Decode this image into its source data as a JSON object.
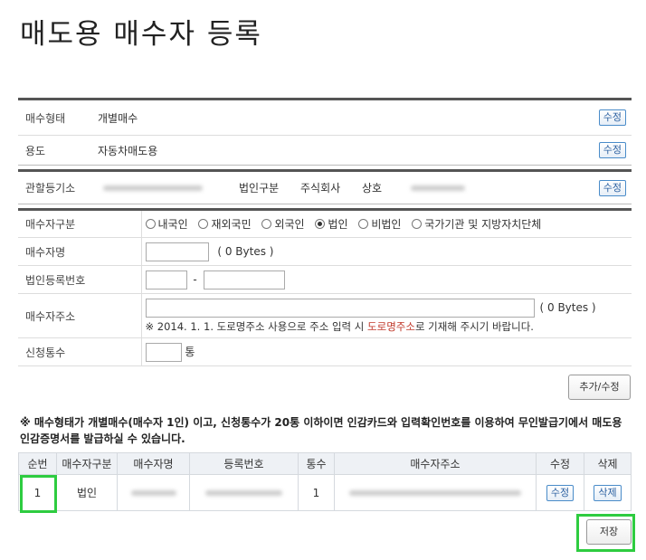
{
  "page_title": "매도용 매수자 등록",
  "top_info": {
    "buy_type_label": "매수형태",
    "buy_type_value": "개별매수",
    "usage_label": "용도",
    "usage_value": "자동차매도용",
    "edit_label": "수정"
  },
  "registry": {
    "office_label": "관할등기소",
    "corp_type_label": "법인구분",
    "corp_type_value": "주식회사",
    "name_label": "상호",
    "edit_label": "수정"
  },
  "form": {
    "buyer_type_label": "매수자구분",
    "buyer_type_options": [
      "내국인",
      "재외국민",
      "외국인",
      "법인",
      "비법인",
      "국가기관 및 지방자치단체"
    ],
    "buyer_type_selected": "법인",
    "buyer_name_label": "매수자명",
    "bytes_text": "(  0   Bytes )",
    "corp_reg_no_label": "법인등록번호",
    "dash": "-",
    "address_label": "매수자주소",
    "address_bytes_text": "(   0    Bytes )",
    "address_note_prefix": "※ 2014. 1. 1. 도로명주소 사용으로 주소 입력 시 ",
    "address_note_highlight": "도로명주소",
    "address_note_suffix": "로 기재해 주시기 바랍니다.",
    "copies_label": "신청통수",
    "copies_unit": "통"
  },
  "add_edit_button": "추가/수정",
  "notice": "※ 매수형태가 개별매수(매수자 1인) 이고, 신청통수가 20통 이하이면 인감카드와 입력확인번호를 이용하여 무인발급기에서 매도용 인감증명서를 발급하실 수 있습니다.",
  "list": {
    "headers": [
      "순번",
      "매수자구분",
      "매수자명",
      "등록번호",
      "통수",
      "매수자주소",
      "수정",
      "삭제"
    ],
    "rows": [
      {
        "no": "1",
        "type": "법인",
        "copies": "1",
        "edit": "수정",
        "delete": "삭제"
      }
    ]
  },
  "save_button": "저장",
  "colors": {
    "accent_green": "#2ecc40",
    "button_blue": "#2a5fa0",
    "highlight_red": "#c0392b"
  }
}
